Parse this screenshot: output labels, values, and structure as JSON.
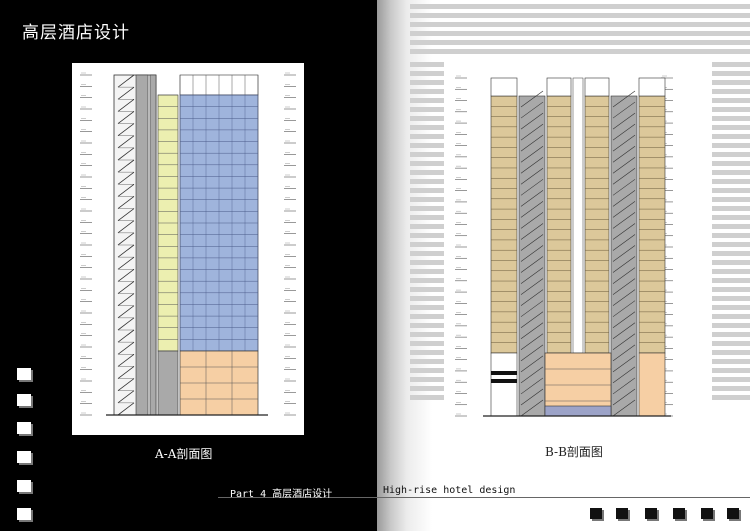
{
  "header": {
    "title": "高层酒店设计"
  },
  "drawings": [
    {
      "caption": "A-A剖面图"
    },
    {
      "caption": "B-B剖面图"
    }
  ],
  "footer": {
    "part_label": "Part 4 高层酒店设计",
    "english_label": "High-rise hotel design"
  },
  "colors": {
    "left_background": "#000000",
    "right_background": "#ffffff",
    "guestroom_blue": "#9fb4dc",
    "core_yellow": "#ecefb0",
    "podium_orange": "#f6cfa4",
    "room_tan": "#dcc89a",
    "core_gray": "#a9a9a9"
  }
}
